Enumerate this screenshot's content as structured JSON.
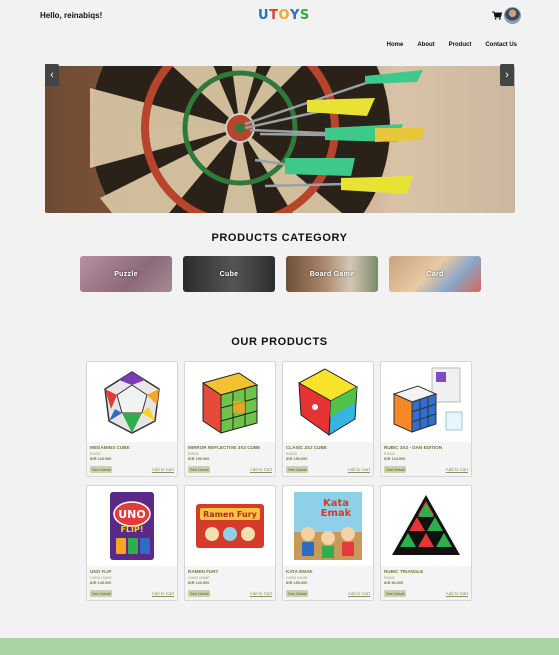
{
  "header": {
    "greeting": "Hello, reinabiqs!",
    "logo_letters": [
      "U",
      "T",
      "O",
      "Y",
      "S"
    ],
    "logo_colors": [
      "#2d6cc4",
      "#e43c3c",
      "#f5a623",
      "#2d6cc4",
      "#3aa34a"
    ]
  },
  "nav": [
    "Home",
    "About",
    "Product",
    "Contact Us"
  ],
  "carousel": {
    "prev": "‹",
    "next": "›"
  },
  "categories": {
    "title": "PRODUCTS CATEGORY",
    "items": [
      "Puzzle",
      "Cube",
      "Board Game",
      "Card"
    ]
  },
  "products": {
    "title": "OUR PRODUCTS",
    "detail_label": "See Detail",
    "cart_label": "Add to Cart",
    "items": [
      {
        "name": "MEGAMINX CUBE",
        "category": "RUBIC",
        "price": "IDR 120.000"
      },
      {
        "name": "MIRROR REFLECTIVE 3X3 CUBE",
        "category": "RUBIC",
        "price": "IDR 190.000"
      },
      {
        "name": "CLASIC 2X2 CUBE",
        "category": "RUBIC",
        "price": "IDR 150.000"
      },
      {
        "name": "RUBIC 3X3 - GAN EDITION",
        "category": "RUBIC",
        "price": "IDR 124.000"
      },
      {
        "name": "UNO FLIP",
        "category": "CARD GAME",
        "price": "IDR 145.000"
      },
      {
        "name": "RAMEN FURY",
        "category": "CARD GAME",
        "price": "IDR 120.000"
      },
      {
        "name": "KATA EMAK",
        "category": "CARD GAME",
        "price": "IDR 155.000"
      },
      {
        "name": "RUBIC TRIANGLE",
        "category": "RUBIC",
        "price": "IDR 80.000"
      }
    ]
  },
  "colors": {
    "footer": "#a9d3a1",
    "accent": "#6e7b32"
  }
}
